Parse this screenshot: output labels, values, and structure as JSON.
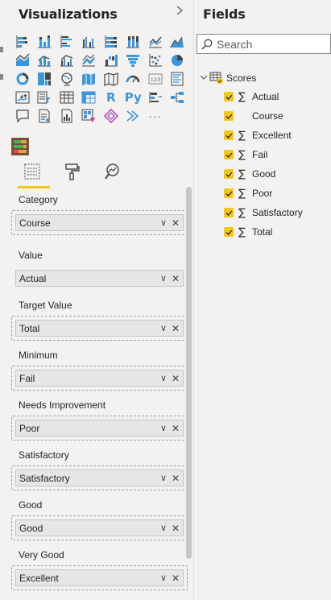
{
  "visualizations": {
    "title": "Visualizations",
    "collapse_icon": "chevron-right-icon",
    "gallery": [
      [
        "stacked-bar-icon",
        "stacked-column-icon",
        "clustered-bar-icon",
        "clustered-column-icon",
        "100-stacked-bar-icon",
        "100-stacked-column-icon",
        "line-chart-icon",
        "area-chart-icon"
      ],
      [
        "stacked-area-icon",
        "line-stacked-column-icon",
        "line-clustered-column-icon",
        "ribbon-chart-icon",
        "waterfall-icon",
        "funnel-icon",
        "scatter-icon",
        "pie-chart-icon"
      ],
      [
        "donut-chart-icon",
        "treemap-icon",
        "map-icon",
        "filled-map-icon",
        "shape-map-icon",
        "gauge-icon",
        "card-icon",
        "multi-row-card-icon"
      ],
      [
        "kpi-icon",
        "slicer-icon",
        "table-icon",
        "matrix-icon",
        "r-visual-icon",
        "python-visual-icon",
        "key-influencers-icon",
        "decomposition-tree-icon"
      ],
      [
        "qa-icon",
        "smart-narrative-icon",
        "paginated-report-icon",
        "power-apps-icon",
        "power-automate-icon",
        "arcgis-icon",
        "more-visuals-icon"
      ]
    ],
    "r_label": "R",
    "py_label": "Py",
    "more_label": "···",
    "custom_visual": "custom-bullet-chart-icon",
    "tabs": [
      "fields-tab",
      "format-tab",
      "analytics-tab"
    ],
    "wells": [
      {
        "label": "Category",
        "value": "Course"
      },
      {
        "label": "Value",
        "value": "Actual"
      },
      {
        "label": "Target Value",
        "value": "Total"
      },
      {
        "label": "Minimum",
        "value": "Fail"
      },
      {
        "label": "Needs Improvement",
        "value": "Poor"
      },
      {
        "label": "Satisfactory",
        "value": "Satisfactory"
      },
      {
        "label": "Good",
        "value": "Good"
      },
      {
        "label": "Very Good",
        "value": "Excellent"
      }
    ],
    "accent": "#f2c811"
  },
  "fields": {
    "title": "Fields",
    "search_placeholder": "Search",
    "table_name": "Scores",
    "items": [
      {
        "name": "Actual",
        "sigma": "∑"
      },
      {
        "name": "Course",
        "sigma": ""
      },
      {
        "name": "Excellent",
        "sigma": "∑"
      },
      {
        "name": "Fail",
        "sigma": "∑"
      },
      {
        "name": "Good",
        "sigma": "∑"
      },
      {
        "name": "Poor",
        "sigma": "∑"
      },
      {
        "name": "Satisfactory",
        "sigma": "∑"
      },
      {
        "name": "Total",
        "sigma": "∑"
      }
    ]
  }
}
